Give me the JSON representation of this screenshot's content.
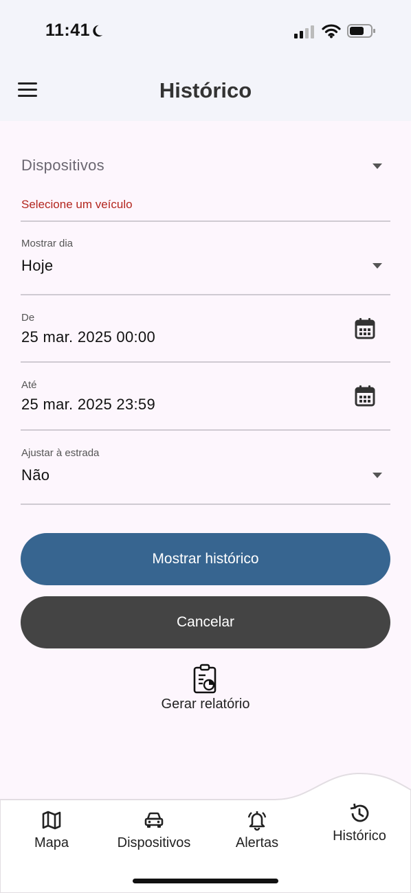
{
  "status": {
    "time": "11:41"
  },
  "header": {
    "title": "Histórico"
  },
  "form": {
    "device": {
      "placeholder": "Dispositivos",
      "error": "Selecione um veículo"
    },
    "day": {
      "label": "Mostrar dia",
      "value": "Hoje"
    },
    "from": {
      "label": "De",
      "value": "25 mar. 2025 00:00"
    },
    "to": {
      "label": "Até",
      "value": "25 mar. 2025 23:59"
    },
    "snap": {
      "label": "Ajustar à estrada",
      "value": "Não"
    }
  },
  "actions": {
    "show_history": "Mostrar histórico",
    "cancel": "Cancelar",
    "report": "Gerar relatório"
  },
  "nav": {
    "items": [
      {
        "label": "Mapa",
        "icon": "map-icon"
      },
      {
        "label": "Dispositivos",
        "icon": "car-icon"
      },
      {
        "label": "Alertas",
        "icon": "bell-icon"
      },
      {
        "label": "Histórico",
        "icon": "history-icon",
        "active": true
      }
    ]
  },
  "colors": {
    "primary": "#376590",
    "secondary": "#444444",
    "error": "#b3261e",
    "background": "#fdf6fd"
  }
}
